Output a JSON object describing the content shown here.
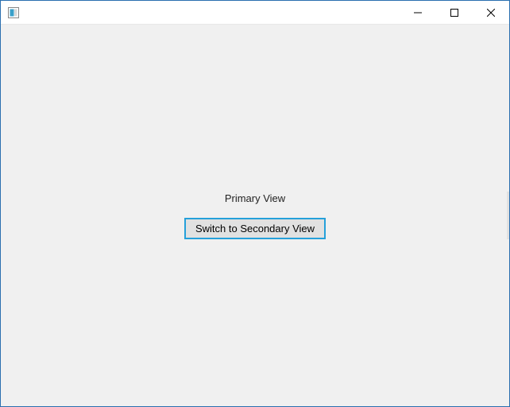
{
  "window": {
    "title": ""
  },
  "main": {
    "view_label": "Primary View",
    "switch_button_label": "Switch to Secondary View"
  }
}
